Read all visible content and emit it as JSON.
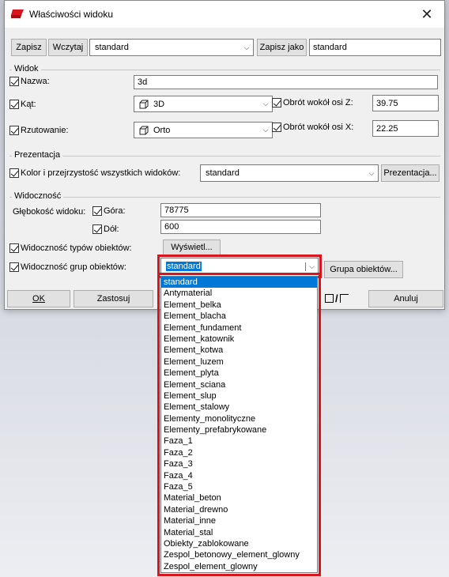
{
  "window": {
    "title": "Właściwości widoku",
    "close_glyph": "✕"
  },
  "top": {
    "save": "Zapisz",
    "load": "Wczytaj",
    "preset_value": "standard",
    "save_as": "Zapisz jako",
    "save_as_value": "standard"
  },
  "view": {
    "group": "Widok",
    "name_label": "Nazwa:",
    "name_value": "3d",
    "angle_label": "Kąt:",
    "angle_value": "3D",
    "rot_z_label": "Obrót wokół osi Z:",
    "rot_z_value": "39.75",
    "proj_label": "Rzutowanie:",
    "proj_value": "Orto",
    "rot_x_label": "Obrót wokół osi X:",
    "rot_x_value": "22.25"
  },
  "presentation": {
    "group": "Prezentacja",
    "color_label": "Kolor i przejrzystość wszystkich widoków:",
    "color_value": "standard",
    "button": "Prezentacja..."
  },
  "visibility": {
    "group": "Widoczność",
    "depth_label": "Głębokość widoku:",
    "top_label": "Góra:",
    "top_value": "78775",
    "bottom_label": "Dół:",
    "bottom_value": "600",
    "types_label": "Widoczność typów obiektów:",
    "types_button": "Wyświetl...",
    "groups_label": "Widoczność grup obiektów:",
    "groups_value": "standard",
    "groups_button": "Grupa obiektów..."
  },
  "footer": {
    "ok": "OK",
    "apply": "Zastosuj",
    "cancel": "Anuluj",
    "toggle": "/"
  },
  "dropdown_items": [
    "standard",
    "Antymaterial",
    "Element_belka",
    "Element_blacha",
    "Element_fundament",
    "Element_katownik",
    "Element_kotwa",
    "Element_luzem",
    "Element_plyta",
    "Element_sciana",
    "Element_slup",
    "Element_stalowy",
    "Elementy_monolityczne",
    "Elementy_prefabrykowane",
    "Faza_1",
    "Faza_2",
    "Faza_3",
    "Faza_4",
    "Faza_5",
    "Material_beton",
    "Material_drewno",
    "Material_inne",
    "Material_stal",
    "Obiekty_zablokowane",
    "Zespol_betonowy_element_glowny",
    "Zespol_element_glowny"
  ],
  "colors": {
    "highlight": "#0078d7",
    "annotation": "#d9141c"
  }
}
